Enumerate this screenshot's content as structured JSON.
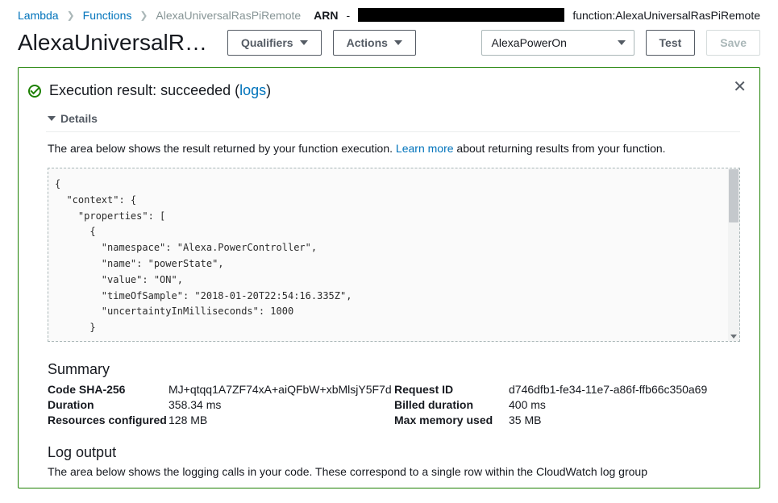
{
  "breadcrumb": {
    "root": "Lambda",
    "functions": "Functions",
    "current": "AlexaUniversalRasPiRemote",
    "arn_label": "ARN",
    "arn_dash": "-",
    "arn_suffix": "function:AlexaUniversalRasPiRemote"
  },
  "header": {
    "title": "AlexaUniversalRasPiRemote",
    "qualifiers": "Qualifiers",
    "actions": "Actions",
    "select_value": "AlexaPowerOn",
    "test": "Test",
    "save": "Save"
  },
  "result": {
    "prefix": "Execution result: succeeded (",
    "logs_link": "logs",
    "suffix": ")",
    "details": "Details",
    "desc_prefix": "The area below shows the result returned by your function execution. ",
    "learn_more": "Learn more",
    "desc_suffix": " about returning results from your function.",
    "json": "{\n  \"context\": {\n    \"properties\": [\n      {\n        \"namespace\": \"Alexa.PowerController\",\n        \"name\": \"powerState\",\n        \"value\": \"ON\",\n        \"timeOfSample\": \"2018-01-20T22:54:16.335Z\",\n        \"uncertaintyInMilliseconds\": 1000\n      }"
  },
  "summary": {
    "title": "Summary",
    "sha_label": "Code SHA-256",
    "sha_value": "MJ+qtqq1A7ZF74xA+aiQFbW+xbMlsjY5F7d",
    "request_id_label": "Request ID",
    "request_id_value": "d746dfb1-fe34-11e7-a86f-ffb66c350a69",
    "duration_label": "Duration",
    "duration_value": "358.34 ms",
    "billed_label": "Billed duration",
    "billed_value": "400 ms",
    "resources_label": "Resources configured",
    "resources_value": "128 MB",
    "maxmem_label": "Max memory used",
    "maxmem_value": "35 MB"
  },
  "log": {
    "title": "Log output",
    "desc": "The area below shows the logging calls in your code. These correspond to a single row within the CloudWatch log group"
  }
}
